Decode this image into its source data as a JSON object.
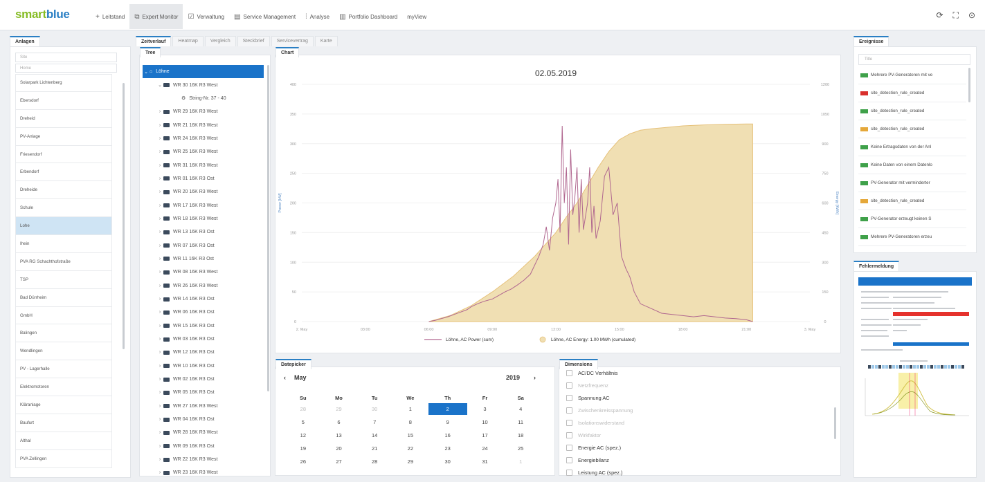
{
  "header": {
    "logo_smart": "smart",
    "logo_blue": "blue",
    "nav": [
      {
        "icon": "+",
        "label": "Leitstand"
      },
      {
        "icon": "⧉",
        "label": "Expert Monitor"
      },
      {
        "icon": "☑",
        "label": "Verwaltung"
      },
      {
        "icon": "▤",
        "label": "Service Management"
      },
      {
        "icon": "⫶",
        "label": "Analyse"
      },
      {
        "icon": "▥",
        "label": "Portfolio Dashboard"
      },
      {
        "icon": "",
        "label": "myView"
      }
    ],
    "right_icons": [
      "refresh-icon",
      "fullscreen-icon",
      "user-icon"
    ]
  },
  "anlagen": {
    "tab": "Anlagen",
    "search_placeholder": "Site",
    "home": "Home",
    "items": [
      "Solarpark Lichtenberg",
      "Ebersdorf",
      "Dreheid",
      "PV-Anlage",
      "Friesendorf",
      "Erbendorf",
      "Dreheide",
      "Schule",
      "Lohe",
      "Ihein",
      "PVA RG Schachthofstraße",
      "TSP",
      "Bad Dürrheim",
      "GmbH",
      "Balingen",
      "Wendlingen",
      "PV - Lagerhalle",
      "Elektromotoren",
      "Kläranlage",
      "Baufurt",
      "Althal",
      "PVA Zellingen"
    ],
    "selected": "Lohe"
  },
  "main_tabs": [
    "Zeitverlauf",
    "Heatmap",
    "Vergleich",
    "Steckbrief",
    "Servicevertrag",
    "Karte"
  ],
  "tree": {
    "title": "Tree",
    "root": "Löhne",
    "expanded": {
      "label": "WR 30 16K R3 West",
      "child": "String-Nr. 37 - 40"
    },
    "items": [
      "WR 29 16K R3 West",
      "WR 21 16K R3 West",
      "WR 24 16K R3 West",
      "WR 25 16K R3 West",
      "WR 31 16K R3 West",
      "WR 01 16K R3 Ost",
      "WR 20 16K R3 West",
      "WR 17 16K R3 West",
      "WR 18 16K R3 West",
      "WR 13 16K R3 Ost",
      "WR 07 16K R3 Ost",
      "WR 11 16K R3 Ost",
      "WR 08 16K R3 West",
      "WR 26 16K R3 West",
      "WR 14 16K R3 Ost",
      "WR 06 16K R3 Ost",
      "WR 15 16K R3 Ost",
      "WR 03 16K R3 Ost",
      "WR 12 16K R3 Ost",
      "WR 10 16K R3 Ost",
      "WR 02 16K R3 Ost",
      "WR 05 16K R3 Ost",
      "WR 27 16K R3 West",
      "WR 04 16K R3 Ost",
      "WR 28 16K R3 West",
      "WR 09 16K R3 Ost",
      "WR 22 16K R3 West",
      "WR 23 16K R3 West"
    ]
  },
  "chart_panel": {
    "title": "Chart"
  },
  "chart_data": {
    "type": "line",
    "title": "02.05.2019",
    "ylabel": "Power [kW]",
    "y2label": "Energy [kWh]",
    "ylim": [
      0,
      400
    ],
    "y2lim": [
      0,
      1200
    ],
    "yticks": [
      "0",
      "50",
      "100",
      "150",
      "200",
      "250",
      "300",
      "350",
      "400"
    ],
    "y2ticks": [
      "0",
      "150",
      "300",
      "450",
      "600",
      "750",
      "900",
      "1050",
      "1200"
    ],
    "xticks": [
      "2. May",
      "03:00",
      "06:00",
      "09:00",
      "12:00",
      "15:00",
      "18:00",
      "21:00",
      "3. May"
    ],
    "series": [
      {
        "name": "Löhne, AC Power (sum)",
        "color": "#b0668f",
        "axis": "left",
        "x": [
          6,
          6.3,
          6.6,
          6.9,
          7.2,
          7.5,
          7.8,
          8,
          8.3,
          8.6,
          9,
          9.3,
          9.6,
          9.9,
          10.2,
          10.5,
          10.8,
          11,
          11.2,
          11.4,
          11.55,
          11.7,
          11.85,
          12,
          12.1,
          12.2,
          12.3,
          12.4,
          12.5,
          12.6,
          12.7,
          12.8,
          12.9,
          13,
          13.1,
          13.2,
          13.3,
          13.5,
          13.6,
          13.7,
          13.8,
          13.9,
          14.1,
          14.3,
          14.5,
          14.7,
          14.9,
          15.1,
          15.3,
          15.5,
          15.7,
          16,
          16.5,
          17,
          17.5,
          18,
          18.5,
          19,
          19.5,
          20,
          20.5,
          21,
          21.3
        ],
        "y": [
          0,
          2,
          5,
          8,
          12,
          16,
          20,
          25,
          30,
          34,
          38,
          44,
          50,
          55,
          62,
          70,
          80,
          95,
          110,
          130,
          160,
          120,
          175,
          200,
          240,
          150,
          330,
          200,
          260,
          130,
          290,
          180,
          210,
          260,
          150,
          240,
          155,
          200,
          260,
          150,
          195,
          140,
          170,
          245,
          260,
          180,
          200,
          110,
          90,
          75,
          50,
          30,
          22,
          14,
          12,
          10,
          8,
          10,
          8,
          6,
          5,
          3,
          0
        ]
      },
      {
        "name": "Löhne, AC Energy: 1.00 MWh (cumulated)",
        "color": "#e6c17a",
        "fill": "#f0dfb3",
        "axis": "right",
        "x": [
          6,
          7,
          8,
          9,
          10,
          11,
          12,
          12.5,
          13,
          13.5,
          14,
          14.5,
          15,
          15.5,
          16,
          16.5,
          17,
          18,
          19,
          20,
          21,
          21.3
        ],
        "y": [
          0,
          30,
          80,
          150,
          230,
          330,
          450,
          530,
          600,
          690,
          780,
          860,
          920,
          950,
          968,
          975,
          980,
          990,
          995,
          998,
          1000,
          1000
        ]
      }
    ]
  },
  "datepicker": {
    "title": "Datepicker",
    "month": "May",
    "year": "2019",
    "prev": "‹",
    "next": "›",
    "weekdays": [
      "Su",
      "Mo",
      "Tu",
      "We",
      "Th",
      "Fr",
      "Sa"
    ],
    "weeks": [
      [
        "28",
        "29",
        "30",
        "1",
        "2",
        "3",
        "4"
      ],
      [
        "5",
        "6",
        "7",
        "8",
        "9",
        "10",
        "11"
      ],
      [
        "12",
        "13",
        "14",
        "15",
        "16",
        "17",
        "18"
      ],
      [
        "19",
        "20",
        "21",
        "22",
        "23",
        "24",
        "25"
      ],
      [
        "26",
        "27",
        "28",
        "29",
        "30",
        "31",
        "1"
      ]
    ],
    "selected": "2"
  },
  "dimensions": {
    "title": "Dimensions",
    "items": [
      {
        "label": "AC/DC Verhältnis",
        "enabled": true
      },
      {
        "label": "Netzfrequenz",
        "enabled": false
      },
      {
        "label": "Spannung AC",
        "enabled": true
      },
      {
        "label": "Zwischenkreisspannung",
        "enabled": false
      },
      {
        "label": "Isolationswiderstand",
        "enabled": false
      },
      {
        "label": "Wirkfaktor",
        "enabled": false
      },
      {
        "label": "Energie AC (spez.)",
        "enabled": true
      },
      {
        "label": "Energiebilanz",
        "enabled": true
      },
      {
        "label": "Leistung AC (spez.)",
        "enabled": true
      }
    ]
  },
  "ereignisse": {
    "tab": "Ereignisse",
    "filter_placeholder": "Title",
    "items": [
      {
        "label": "Mehrere PV-Generatoren mit ve",
        "color": "#3fa14a"
      },
      {
        "label": "site_detection_rule_created",
        "color": "#d9302c"
      },
      {
        "label": "site_detection_rule_created",
        "color": "#3fa14a"
      },
      {
        "label": "site_detection_rule_created",
        "color": "#e5a83a"
      },
      {
        "label": "Keine Ertragsdaten von der Anl",
        "color": "#3fa14a"
      },
      {
        "label": "Keine Daten von einem Datenlo",
        "color": "#3fa14a"
      },
      {
        "label": "PV-Generator mit verminderter",
        "color": "#3fa14a"
      },
      {
        "label": "site_detection_rule_created",
        "color": "#e5a83a"
      },
      {
        "label": "PV-Generator erzeugt keinen S",
        "color": "#3fa14a"
      },
      {
        "label": "Mehrere PV-Generatoren erzeu",
        "color": "#3fa14a"
      }
    ]
  },
  "fehlermeldung": {
    "tab": "Fehlermeldung"
  }
}
